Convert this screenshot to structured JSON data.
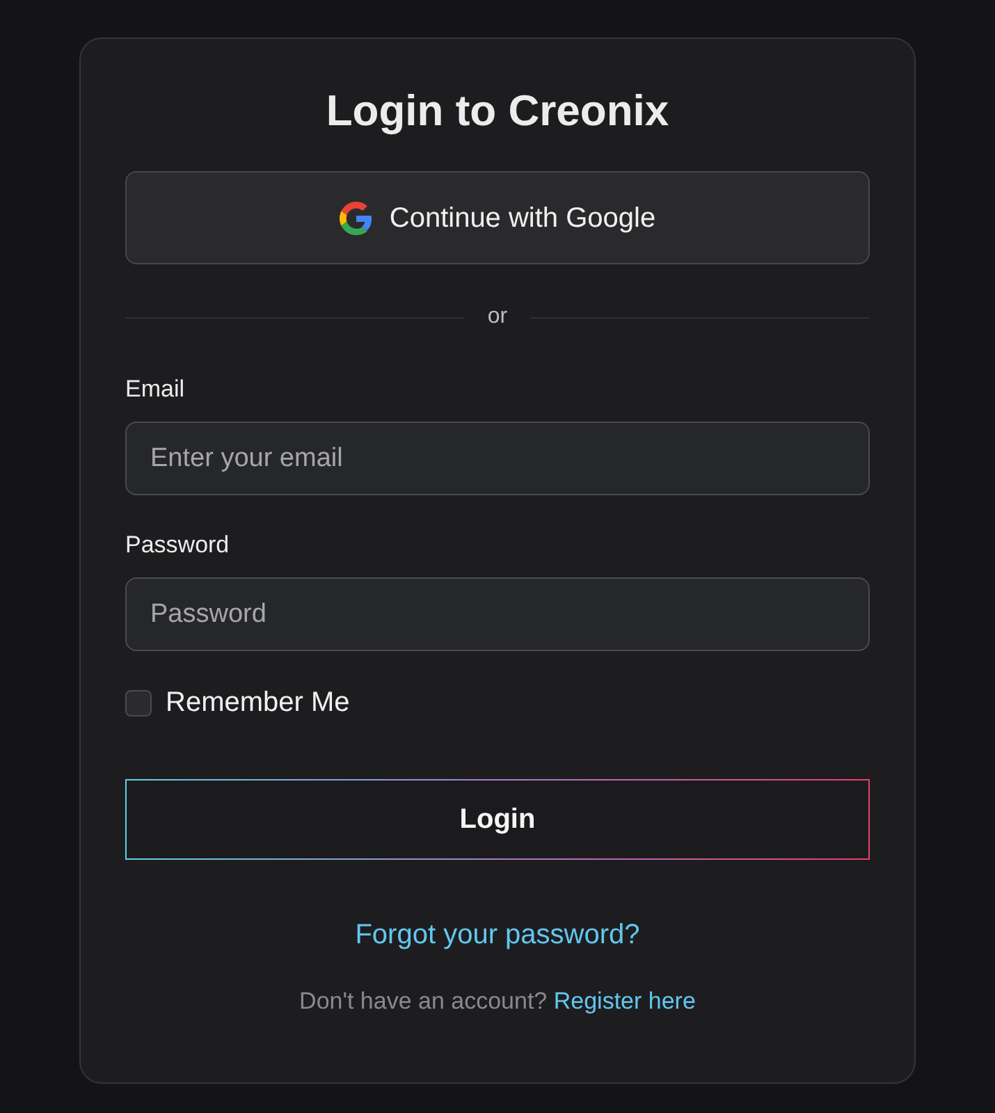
{
  "title": "Login to Creonix",
  "google_button": {
    "label": "Continue with Google"
  },
  "divider": {
    "label": "or"
  },
  "fields": [
    {
      "label": "Email",
      "placeholder": "Enter your email"
    },
    {
      "label": "Password",
      "placeholder": "Password"
    }
  ],
  "remember": {
    "label": "Remember Me",
    "checked": false
  },
  "login_button": {
    "label": "Login"
  },
  "forgot_link": "Forgot your password?",
  "register": {
    "prompt": "Don't have an account?",
    "link": "Register here"
  }
}
